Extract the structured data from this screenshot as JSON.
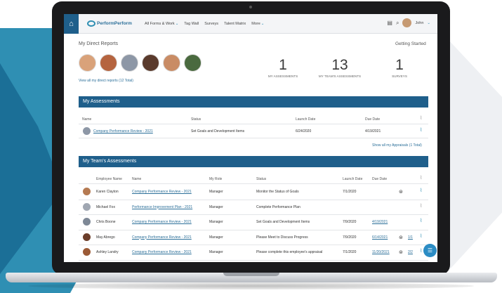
{
  "nav": {
    "logo_text": "PerformPerform",
    "menu": [
      {
        "label": "All Forms & Work",
        "chevron": true
      },
      {
        "label": "Tag Wall",
        "chevron": false
      },
      {
        "label": "Surveys",
        "chevron": false
      },
      {
        "label": "Talent Matrix",
        "chevron": false
      },
      {
        "label": "More",
        "chevron": true
      }
    ],
    "user_name": "John"
  },
  "direct_reports": {
    "title": "My Direct Reports",
    "getting_started": "Getting Started",
    "view_all": "View all my direct reports (12 Total)",
    "avatar_colors": [
      "#d9a27a",
      "#b5643f",
      "#8d97a6",
      "#5a3a2c",
      "#c98c65",
      "#4a6a3f"
    ],
    "stats": [
      {
        "value": "1",
        "label": "MY ASSESSMENTS"
      },
      {
        "value": "13",
        "label": "MY TEAM'S ASSESSMENTS"
      },
      {
        "value": "1",
        "label": "SURVEYS"
      }
    ]
  },
  "my_assessments": {
    "title": "My Assessments",
    "headers": {
      "name": "Name",
      "status": "Status",
      "launch": "Launch Date",
      "due": "Due Date"
    },
    "rows": [
      {
        "name": "Company Performance Review - 2021",
        "status": "Set Goals and Development Items",
        "launch": "6/24/2020",
        "due": "4/19/2021"
      }
    ],
    "show_all": "Show all my Appraisals (1 Total)"
  },
  "team_assessments": {
    "title": "My Team's Assessments",
    "headers": {
      "employee": "Employee Name",
      "name": "Name",
      "role": "My Role",
      "status": "Status",
      "launch": "Launch Date",
      "due": "Due Date"
    },
    "rows": [
      {
        "employee": "Karen Clayton",
        "name": "Company Performance Review - 2021",
        "role": "Manager",
        "status": "Monitor the Status of Goals",
        "launch": "7/1/2020",
        "due": "",
        "badge": "",
        "avatar": "#b57a52"
      },
      {
        "employee": "Michael Fox",
        "name": "Performance Improvement Plan - 2021",
        "role": "Manager",
        "status": "Complete Performance Plan",
        "launch": "",
        "due": "",
        "badge": "",
        "avatar": "#a0a7b2"
      },
      {
        "employee": "Chris Boone",
        "name": "Company Performance Review - 2021",
        "role": "Manager",
        "status": "Set Goals and Development Items",
        "launch": "7/9/2020",
        "due": "4/19/2021",
        "badge": "",
        "avatar": "#7e8896"
      },
      {
        "employee": "May Abrego",
        "name": "Company Performance Review - 2021",
        "role": "Manager",
        "status": "Please Meet to Discuss Progress",
        "launch": "7/9/2020",
        "due": "6/14/2021",
        "badge": "1/1",
        "avatar": "#6b3e2a"
      },
      {
        "employee": "Ashley Landry",
        "name": "Company Performance Review - 2021",
        "role": "Manager",
        "status": "Please complete this employee's appraisal",
        "launch": "7/1/2020",
        "due": "11/20/2021",
        "badge": "2/2",
        "avatar": "#9b5a36"
      }
    ]
  }
}
